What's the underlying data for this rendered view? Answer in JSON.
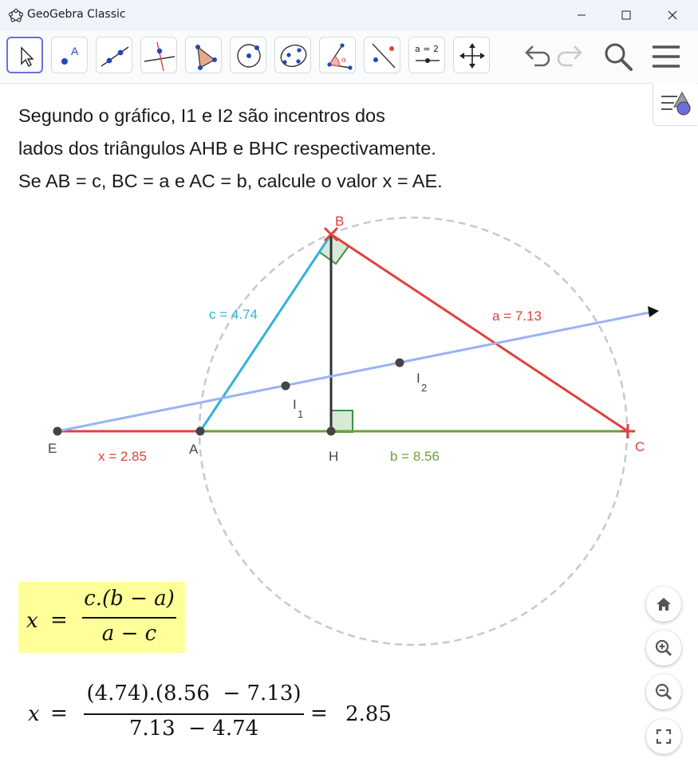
{
  "window": {
    "title": "GeoGebra Classic"
  },
  "toolbar": {
    "tools": [
      "move-tool",
      "point-tool",
      "line-tool",
      "perpendicular-line-tool",
      "polygon-tool",
      "circle-center-point-tool",
      "conic-five-points-tool",
      "angle-tool",
      "reflect-tool",
      "slider-tool",
      "move-graphics-view-tool"
    ],
    "slider_label": "a = 2",
    "undo": "undo-icon",
    "redo": "redo-icon",
    "search": "search-icon",
    "menu": "menu-icon"
  },
  "problem": {
    "line1": "Segundo o gráfico, I1 e I2 são incentros dos",
    "line2": "lados dos triângulos AHB e BHC respectivamente.",
    "line3": "Se AB = c, BC = a e AC = b, calcule o valor x = AE."
  },
  "graph": {
    "points": {
      "B": "B",
      "E": "E",
      "A": "A",
      "H": "H",
      "C": "C",
      "I1": "I",
      "I1_sub": "1",
      "I2": "I",
      "I2_sub": "2"
    },
    "segments": {
      "c_label": "c = 4.74",
      "a_label": "a = 7.13",
      "x_label": "x = 2.85",
      "b_label": "b = 8.56"
    },
    "colors": {
      "red": "#e0413d",
      "cyan": "#33b1d9",
      "green": "#6da236",
      "blue_line": "#99b3f5",
      "black": "#333333",
      "circle": "#c8c8c8"
    }
  },
  "formula": {
    "x": "x",
    "eq": "=",
    "numerator": "c.(b − a)",
    "denominator": "a − c",
    "highlight": "#ffff99"
  },
  "calculation": {
    "x": "x",
    "eq": "=",
    "numerator": "(4.74).(8.56  − 7.13)",
    "denominator": "7.13  − 4.74",
    "eq2": "=",
    "result": "2.85"
  },
  "zoom_controls": [
    "home-icon",
    "zoom-in-icon",
    "zoom-out-icon",
    "fullscreen-icon"
  ]
}
